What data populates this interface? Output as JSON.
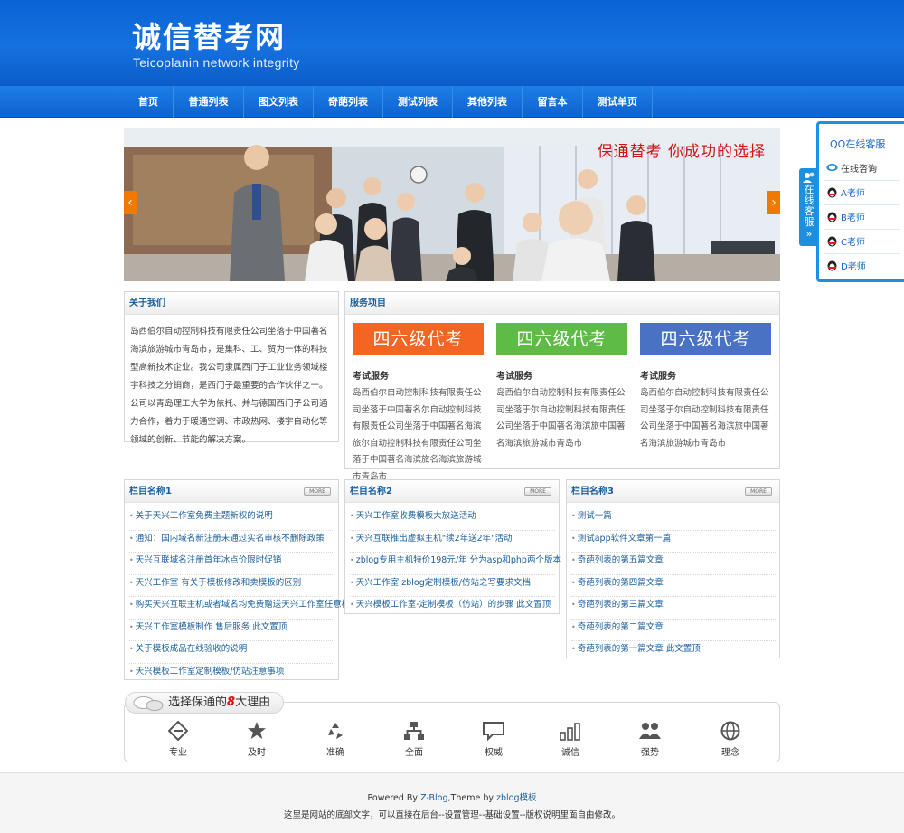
{
  "header": {
    "title": "诚信替考网",
    "subtitle": "Teicoplanin network integrity"
  },
  "nav": {
    "items": [
      "首页",
      "普通列表",
      "图文列表",
      "奇葩列表",
      "测试列表",
      "其他列表",
      "留言本",
      "测试单页"
    ]
  },
  "banner": {
    "slogan": "保通替考 你成功的选择",
    "prev_icon": "chevron-left-icon",
    "next_icon": "chevron-right-icon"
  },
  "qq": {
    "tab_label": "在线客服",
    "tab_arrow": "»",
    "title": "QQ在线客服",
    "consult": "在线咨询",
    "agents": [
      "A老师",
      "B老师",
      "C老师",
      "D老师"
    ]
  },
  "about": {
    "title": "关于我们",
    "text": "岛西伯尔自动控制科技有限责任公司坐落于中国著名海滨旅游城市青岛市，是集科、工、贸为一体的科技型高新技术企业。我公司隶属西门子工业业务领域楼宇科技之分销商，是西门子最重要的合作伙伴之一。 公司以青岛理工大学为依托、并与德国西门子公司通力合作，着力于暖通空调、市政热网、楼宇自动化等领域的创新、节能的解决方案。"
  },
  "services": {
    "title": "服务项目",
    "items": [
      {
        "banner": "四六级代考",
        "color": "#f26522",
        "title": "考试服务",
        "text": "岛西伯尔自动控制科技有限责任公司坐落于中国著名尔自动控制科技有限责任公司坐落于中国著名海滨旅尔自动控制科技有限责任公司坐落于中国著名海滨旅名海滨旅游城市青岛市"
      },
      {
        "banner": "四六级代考",
        "color": "#5dbb46",
        "title": "考试服务",
        "text": "岛西伯尔自动控制科技有限责任公司坐落于尔自动控制科技有限责任公司坐落于中国著名海滨旅中国著名海滨旅游城市青岛市"
      },
      {
        "banner": "四六级代考",
        "color": "#4a72c4",
        "title": "考试服务",
        "text": "岛西伯尔自动控制科技有限责任公司坐落于尔自动控制科技有限责任公司坐落于中国著名海滨旅中国著名海滨旅游城市青岛市"
      }
    ]
  },
  "columns": [
    {
      "title": "栏目名称1",
      "more": "MORE",
      "items": [
        "关于天兴工作室免费主题新权的说明",
        "通知：国内域名新注册未通过实名审核不删除政策",
        "天兴互联域名注册首年冰点价限时促销",
        "天兴工作室 有关于模板修改和卖模板的区别",
        "购买天兴互联主机或者域名均免费赠送天兴工作室任意模板一套",
        "天兴工作室模板制作 售后服务 此文置顶",
        "关于模板成品在线验收的说明",
        "天兴模板工作室定制模板/仿站注意事项"
      ]
    },
    {
      "title": "栏目名称2",
      "more": "MORE",
      "items": [
        "天兴工作室收费模板大放送活动",
        "天兴互联推出虚拟主机\"续2年送2年\"活动",
        "zblog专用主机特价198元/年 分为asp和php两个版本",
        "天兴工作室 zblog定制模板/仿站之写要求文档",
        "天兴模板工作室-定制模板（仿站）的步骤 此文置顶"
      ]
    },
    {
      "title": "栏目名称3",
      "more": "MORE",
      "items": [
        "测试一篇",
        "测试app软件文章第一篇",
        "奇葩列表的第五篇文章",
        "奇葩列表的第四篇文章",
        "奇葩列表的第三篇文章",
        "奇葩列表的第二篇文章",
        "奇葩列表的第一篇文章 此文置顶"
      ]
    }
  ],
  "reasons": {
    "heading_pre": "选择保通的",
    "heading_num": "8",
    "heading_post": "大理由",
    "items": [
      {
        "label": "专业",
        "icon": "tag-icon"
      },
      {
        "label": "及时",
        "icon": "star-icon"
      },
      {
        "label": "准确",
        "icon": "recycle-icon"
      },
      {
        "label": "全面",
        "icon": "sitemap-icon"
      },
      {
        "label": "权威",
        "icon": "chat-icon"
      },
      {
        "label": "诚信",
        "icon": "bar-chart-icon"
      },
      {
        "label": "强势",
        "icon": "team-icon"
      },
      {
        "label": "理念",
        "icon": "globe-icon"
      }
    ]
  },
  "footer": {
    "powered_pre": "Powered By ",
    "powered_link": "Z-Blog",
    "theme_pre": ",Theme by ",
    "theme_link": "zblog模板",
    "note": "这里是网站的底部文字，可以直接在后台--设置管理--基础设置--版权说明里面自由修改。"
  }
}
